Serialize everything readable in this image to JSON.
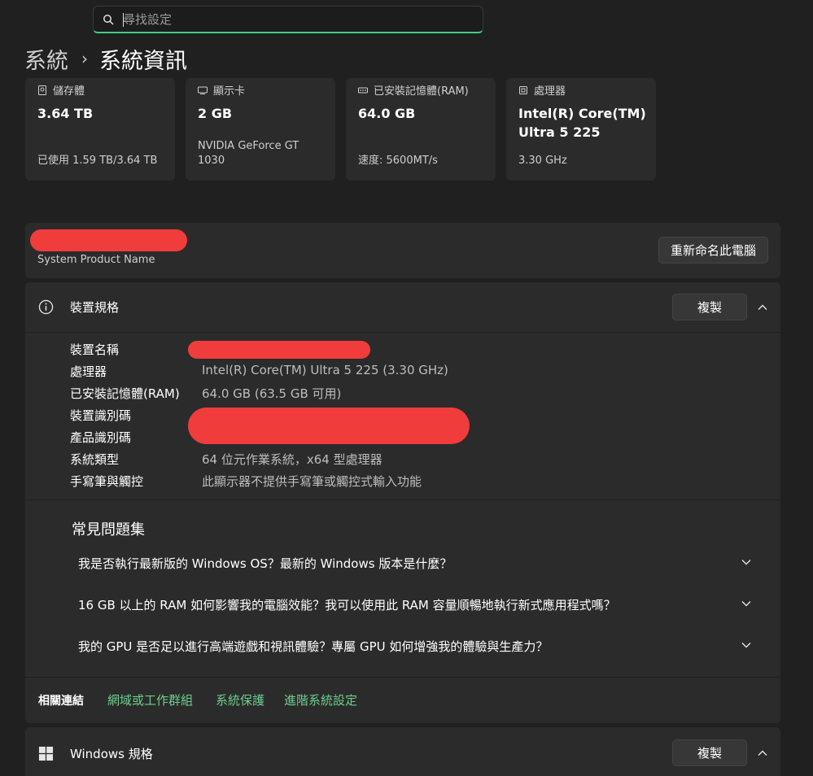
{
  "search": {
    "placeholder": "尋找設定",
    "icon": "search-icon"
  },
  "breadcrumb": {
    "parent": "系統",
    "separator": "›",
    "current": "系統資訊"
  },
  "cards": [
    {
      "label": "儲存體",
      "icon": "storage-icon",
      "value": "3.64 TB",
      "sub": "已使用 1.59 TB/3.64 TB"
    },
    {
      "label": "顯示卡",
      "icon": "display-adapter-icon",
      "value": "2 GB",
      "sub": "NVIDIA GeForce GT 1030"
    },
    {
      "label": "已安裝記憶體(RAM)",
      "icon": "memory-icon",
      "value": "64.0 GB",
      "sub": "速度: 5600MT/s"
    },
    {
      "label": "處理器",
      "icon": "processor-icon",
      "value": "Intel(R) Core(TM) Ultra 5 225",
      "sub": "3.30 GHz"
    }
  ],
  "device": {
    "product_name": "System Product Name",
    "rename_label": "重新命名此電腦"
  },
  "spec": {
    "title": "裝置規格",
    "copy_label": "複製",
    "rows": [
      {
        "key": "裝置名稱",
        "value": ""
      },
      {
        "key": "處理器",
        "value": "Intel(R) Core(TM) Ultra 5 225 (3.30 GHz)"
      },
      {
        "key": "已安裝記憶體(RAM)",
        "value": "64.0 GB (63.5 GB 可用)"
      },
      {
        "key": "裝置識別碼",
        "value": ""
      },
      {
        "key": "產品識別碼",
        "value": ""
      },
      {
        "key": "系統類型",
        "value": "64 位元作業系統，x64 型處理器"
      },
      {
        "key": "手寫筆與觸控",
        "value": "此顯示器不提供手寫筆或觸控式輸入功能"
      }
    ]
  },
  "faq": {
    "title": "常見問題集",
    "questions": [
      "我是否執行最新版的 Windows OS？最新的 Windows 版本是什麼？",
      "16 GB 以上的 RAM 如何影響我的電腦效能？我可以使用此 RAM 容量順暢地執行新式應用程式嗎？",
      "我的 GPU 是否足以進行高端遊戲和視訊體驗？專屬 GPU 如何增強我的體驗與生產力？"
    ]
  },
  "related": {
    "title": "相關連結",
    "links": [
      "網域或工作群組",
      "系統保護",
      "進階系統設定"
    ]
  },
  "windows_spec": {
    "title": "Windows 規格",
    "copy_label": "複製"
  },
  "colors": {
    "accent": "#42d07a",
    "link": "#6ccf8e",
    "redaction": "#f13c3c"
  }
}
